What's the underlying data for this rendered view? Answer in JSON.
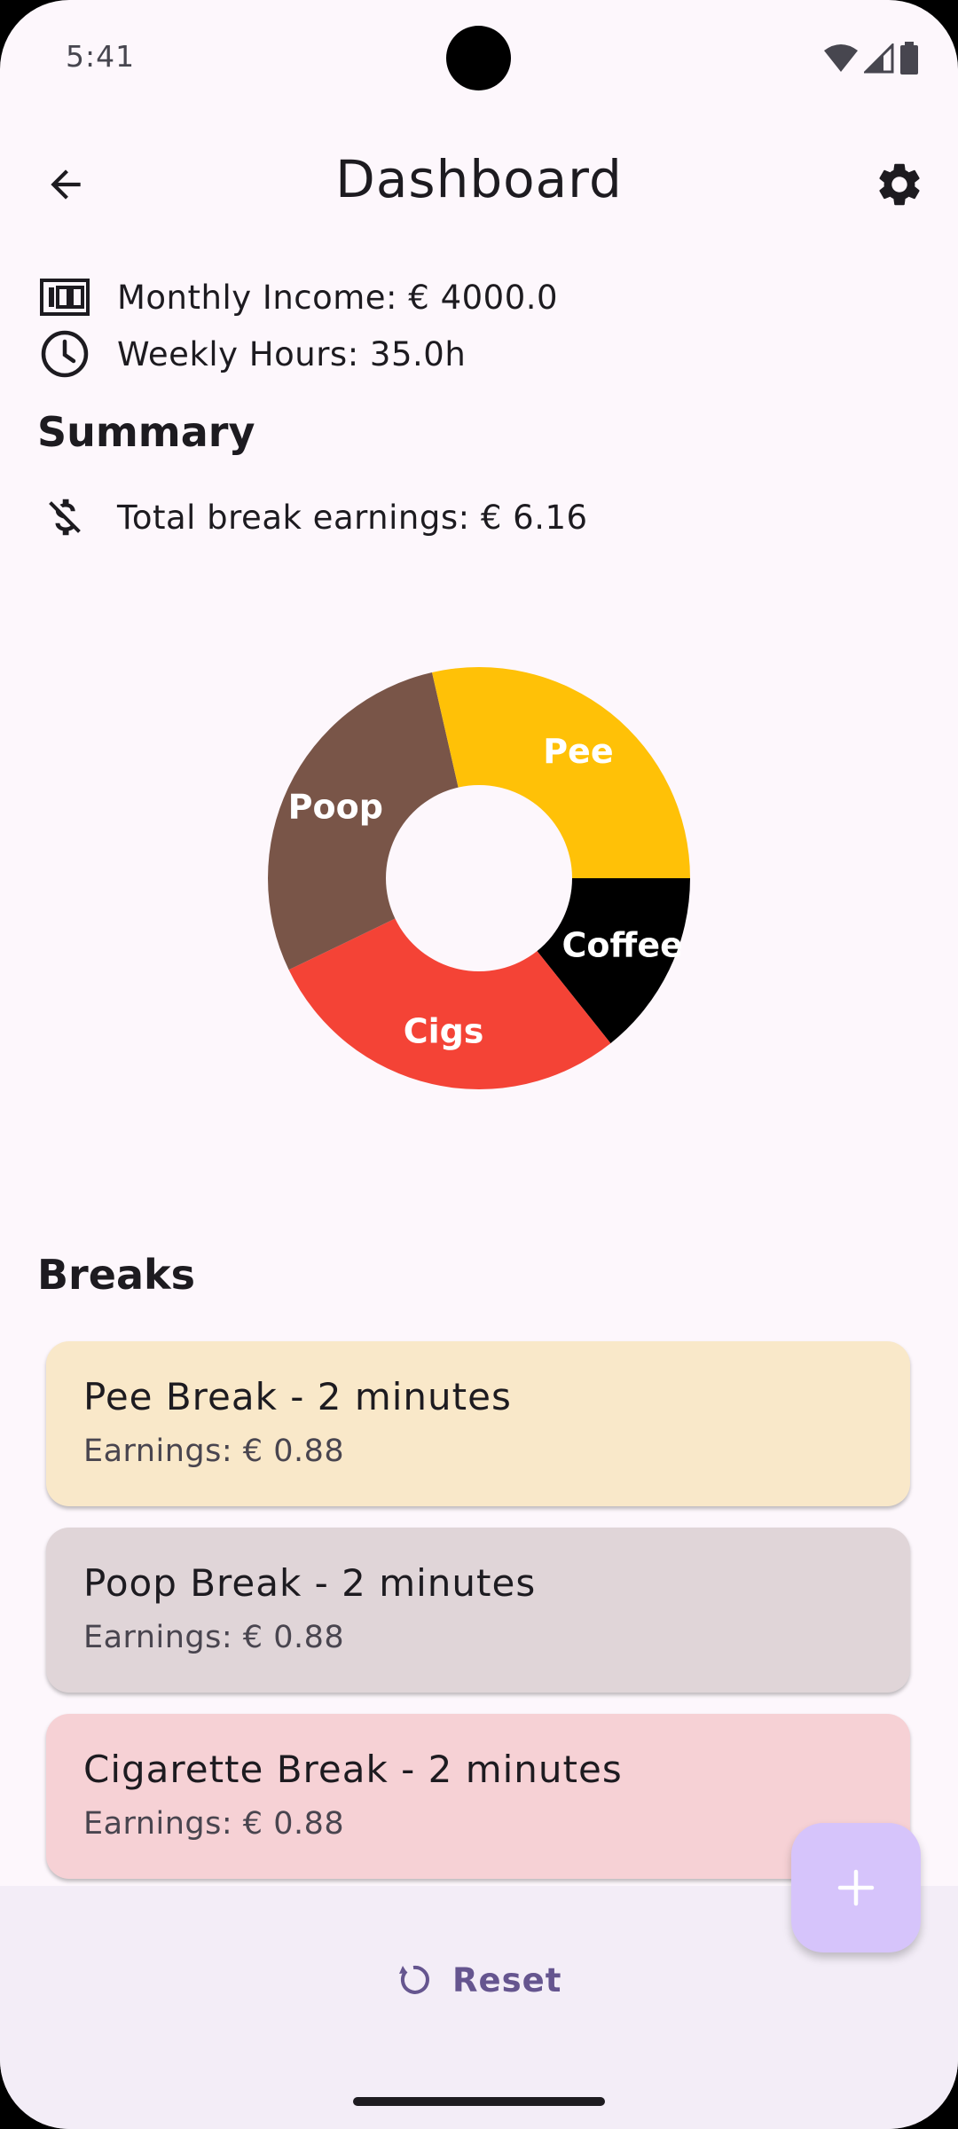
{
  "status_bar": {
    "time": "5:41"
  },
  "app_bar": {
    "title": "Dashboard"
  },
  "info": {
    "monthly_income": "Monthly Income: € 4000.0",
    "weekly_hours": "Weekly Hours: 35.0h"
  },
  "summary": {
    "heading": "Summary",
    "total_break_earnings": "Total break earnings: € 6.16"
  },
  "chart_data": {
    "type": "pie",
    "style": "donut",
    "slices": [
      {
        "label": "Coffee",
        "value": 1,
        "color": "#000000"
      },
      {
        "label": "Cigs",
        "value": 2,
        "color": "#f44336"
      },
      {
        "label": "Poop",
        "value": 2,
        "color": "#795548"
      },
      {
        "label": "Pee",
        "value": 2,
        "color": "#ffc107"
      }
    ]
  },
  "breaks": {
    "heading": "Breaks",
    "items": [
      {
        "title": "Pee Break - 2 minutes",
        "earnings": "Earnings: € 0.88",
        "color": "#f9e8c9"
      },
      {
        "title": "Poop Break - 2 minutes",
        "earnings": "Earnings: € 0.88",
        "color": "#e0d5d8"
      },
      {
        "title": "Cigarette Break - 2 minutes",
        "earnings": "Earnings: € 0.88",
        "color": "#f6d1d5"
      }
    ]
  },
  "bottom": {
    "reset_label": "Reset"
  },
  "icons": {
    "back": "arrow-back-icon",
    "settings": "gear-icon",
    "income": "money-bill-icon",
    "hours": "clock-icon",
    "earnings": "money-off-icon",
    "reset": "reset-icon",
    "add": "plus-icon"
  },
  "colors": {
    "accent": "#65558f",
    "fab": "#d6c4fb",
    "background": "#fdf7fc"
  }
}
